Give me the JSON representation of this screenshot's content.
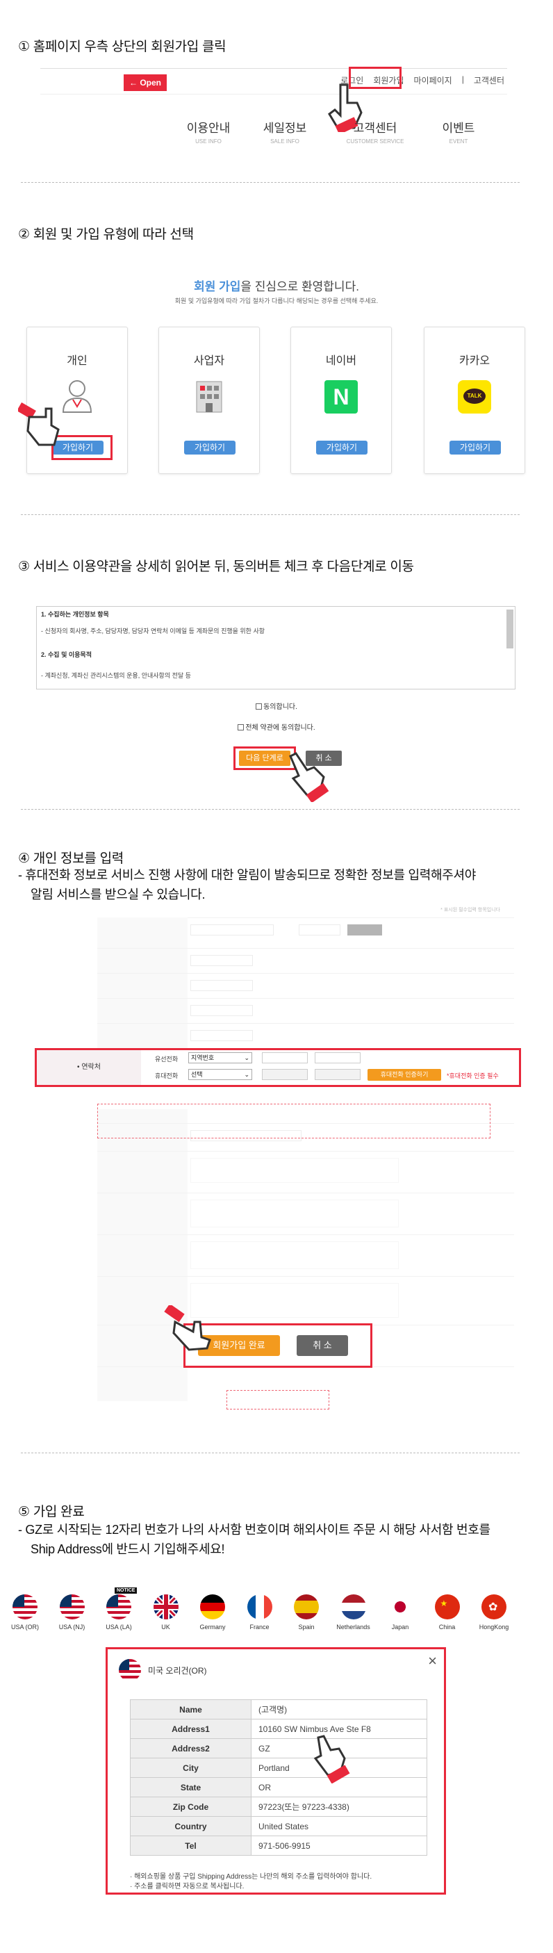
{
  "steps": {
    "s1": "① 홈페이지 우측 상단의 회원가입 클릭",
    "s2": "② 회원 및 가입 유형에 따라 선택",
    "s3": "③ 서비스 이용약관을 상세히 읽어본 뒤, 동의버튼 체크 후 다음단계로 이동",
    "s4": "④ 개인 정보를 입력",
    "s4_desc1": "- 휴대전화 정보로 서비스 진행 사항에 대한 알림이 발송되므로 정확한 정보를 입력해주셔야",
    "s4_desc2": "알림 서비스를 받으실 수 있습니다.",
    "s5": "⑤ 가입 완료",
    "s5_desc1": "- GZ로 시작되는 12자리 번호가 나의 사서함 번호이며 해외사이트 주문 시 해당 사서함 번호를",
    "s5_desc2": "Ship Address에 반드시 기입해주세요!"
  },
  "topbar": {
    "open_label": "Open",
    "links": [
      "로그인",
      "회원가입",
      "마이페이지",
      "|",
      "고객센터"
    ]
  },
  "nav": [
    {
      "title": "이용안내",
      "sub": "USE INFO"
    },
    {
      "title": "세일정보",
      "sub": "SALE INFO"
    },
    {
      "title": "고객센터",
      "sub": "CUSTOMER SERVICE"
    },
    {
      "title": "이벤트",
      "sub": "EVENT"
    }
  ],
  "join": {
    "headline_accent": "회원 가입",
    "headline_rest": "을 진심으로 환영합니다.",
    "subtext": "회원 및 가입유형에 따라 가입 절차가 다릅니다 해당되는 경우를 선택해 주세요.",
    "cards": [
      {
        "title": "개인",
        "btn": "가입하기",
        "icon": "person-icon"
      },
      {
        "title": "사업자",
        "btn": "가입하기",
        "icon": "building-icon"
      },
      {
        "title": "네이버",
        "btn": "가입하기",
        "icon": "naver-icon"
      },
      {
        "title": "카카오",
        "btn": "가입하기",
        "icon": "kakao-icon"
      }
    ],
    "naver_letter": "N",
    "kakao_text": "TALK"
  },
  "terms": {
    "lines": [
      "1. 수집하는 개인정보 항목",
      "- 신청자의 회사명, 주소, 담당자명, 담당자 연락처 이메일 등 계좌문의 진행을 위한 사항",
      "2. 수집 및 이용목적",
      "- 계좌신청, 계좌신 관리시스템의 운용, 안내사항의 전달 등"
    ],
    "agree1": "동의합니다.",
    "agree2": "전체 약관에 동의합니다.",
    "next_btn": "다음 단계로",
    "cancel_btn": "취 소"
  },
  "form": {
    "required_note": "* 표시된 필수입력 항목입니다",
    "contact_label": "연락처",
    "phone_label": "유선전화",
    "phone_select": "지역번호",
    "mobile_label": "휴대전화",
    "mobile_select": "선택",
    "verify_btn": "휴대전화 인증하기",
    "verify_note": "*휴대전화 인증 필수",
    "submit_btn": "회원가입 완료",
    "cancel_btn": "취 소"
  },
  "countries": [
    {
      "name": "USA (OR)",
      "icon": "flag-usa-icon"
    },
    {
      "name": "USA (NJ)",
      "icon": "flag-usa-icon"
    },
    {
      "name": "USA (LA)",
      "icon": "flag-usa-icon",
      "badge": "NOTICE"
    },
    {
      "name": "UK",
      "icon": "flag-uk-icon"
    },
    {
      "name": "Germany",
      "icon": "flag-germany-icon"
    },
    {
      "name": "France",
      "icon": "flag-france-icon"
    },
    {
      "name": "Spain",
      "icon": "flag-spain-icon"
    },
    {
      "name": "Netherlands",
      "icon": "flag-netherlands-icon"
    },
    {
      "name": "Japan",
      "icon": "flag-japan-icon"
    },
    {
      "name": "China",
      "icon": "flag-china-icon"
    },
    {
      "name": "HongKong",
      "icon": "flag-hongkong-icon"
    }
  ],
  "address": {
    "title": "미국 오리건(OR)",
    "close": "×",
    "rows": [
      {
        "k": "Name",
        "v": "(고객명)"
      },
      {
        "k": "Address1",
        "v": "10160 SW Nimbus Ave Ste F8"
      },
      {
        "k": "Address2",
        "v": "GZ"
      },
      {
        "k": "City",
        "v": "Portland"
      },
      {
        "k": "State",
        "v": "OR"
      },
      {
        "k": "Zip Code",
        "v": "97223(또는 97223-4338)"
      },
      {
        "k": "Country",
        "v": "United States"
      },
      {
        "k": "Tel",
        "v": "971-506-9915"
      }
    ],
    "note1": "· 해외쇼핑몰 상품 구입 Shipping Address는 나만의 해외 주소를 입력하여야 합니다.",
    "note2": "· 주소를 클릭하면 자동으로 복사됩니다."
  },
  "colors": {
    "accent_red": "#e8283b",
    "blue": "#4a90d9",
    "orange": "#f39a1e"
  }
}
